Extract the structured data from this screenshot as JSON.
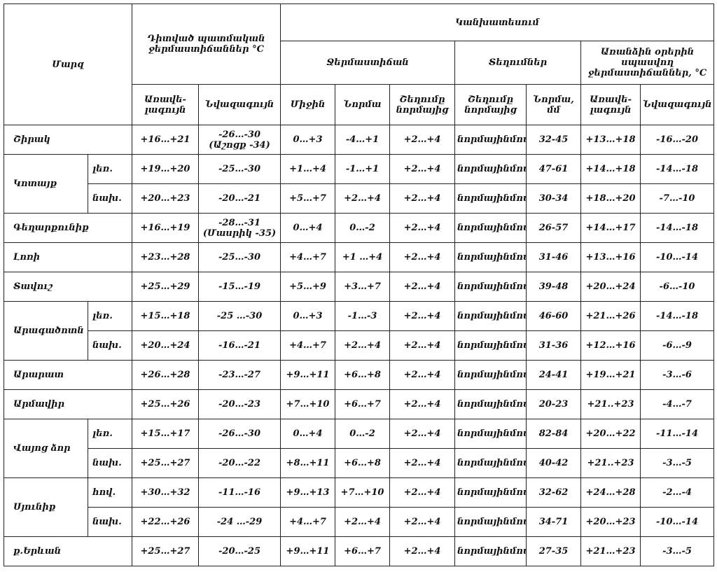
{
  "header": {
    "region": "Մարզ",
    "observed_title": "Դիտված պատմական ջերմաստիճաններ °C",
    "observed_max": "Առավե-լագույն",
    "observed_min": "Նվազագույն",
    "forecast_title": "Կանխատեսում",
    "temperature_title": "Ջերմաստիճան",
    "temp_mean": "Միջին",
    "temp_norm": "Նորմա",
    "temp_deviation": "Շեղումը նորմայից",
    "precip_title": "Տեղումներ",
    "precip_deviation": "Շեղումը նորմայից",
    "precip_norm": "Նորմա, մմ",
    "special_title": "Առանձին օրերին սպասվող ջերմաստիճաններ, °C",
    "special_max": "Առավե-լագույն",
    "special_min": "Նվազագույն"
  },
  "rows": [
    {
      "region": "Շիրակ",
      "sub": "",
      "obs_max": "+16…+21",
      "obs_min": "-26…-30 (Աշոցք -34)",
      "mean": "0…+3",
      "norm": "-4…+1",
      "dev": "+2…+4",
      "precip_dev": "նորմայինմոտ",
      "precip_norm": "32-45",
      "spec_max": "+13…+18",
      "spec_min": "-16…-20"
    },
    {
      "region": "Կոտայք",
      "sub": "լեռ.",
      "obs_max": "+19…+20",
      "obs_min": "-25…-30",
      "mean": "+1…+4",
      "norm": "-1…+1",
      "dev": "+2…+4",
      "precip_dev": "նորմայինմոտ",
      "precip_norm": "47-61",
      "spec_max": "+14…+18",
      "spec_min": "-14…-18"
    },
    {
      "region": "",
      "sub": "նախ.",
      "obs_max": "+20…+23",
      "obs_min": "-20…-21",
      "mean": "+5…+7",
      "norm": "+2…+4",
      "dev": "+2…+4",
      "precip_dev": "նորմայինմոտ",
      "precip_norm": "30-34",
      "spec_max": "+18…+20",
      "spec_min": "-7…-10"
    },
    {
      "region": "Գեղարքունիք",
      "sub": "",
      "obs_max": "+16…+19",
      "obs_min": "-28…-31 (Մասրիկ -35)",
      "mean": "0…+4",
      "norm": "0…-2",
      "dev": "+2…+4",
      "precip_dev": "նորմայինմոտ",
      "precip_norm": "26-57",
      "spec_max": "+14…+17",
      "spec_min": "-14…-18"
    },
    {
      "region": "Լոռի",
      "sub": "",
      "obs_max": "+23…+28",
      "obs_min": "-25…-30",
      "mean": "+4…+7",
      "norm": "+1 …+4",
      "dev": "+2…+4",
      "precip_dev": "նորմայինմոտ",
      "precip_norm": "31-46",
      "spec_max": "+13…+16",
      "spec_min": "-10…-14"
    },
    {
      "region": "Տավուշ",
      "sub": "",
      "obs_max": "+25…+29",
      "obs_min": "-15…-19",
      "mean": "+5…+9",
      "norm": "+3…+7",
      "dev": "+2…+4",
      "precip_dev": "նորմայինմոտ",
      "precip_norm": "39-48",
      "spec_max": "+20…+24",
      "spec_min": "-6…-10"
    },
    {
      "region": "Արագածոտն",
      "sub": "լեռ.",
      "obs_max": "+15…+18",
      "obs_min": "-25 …-30",
      "mean": "0…+3",
      "norm": "-1…-3",
      "dev": "+2…+4",
      "precip_dev": "նորմայինմոտ",
      "precip_norm": "46-60",
      "spec_max": "+21…+26",
      "spec_min": "-14…-18"
    },
    {
      "region": "",
      "sub": "նախ.",
      "obs_max": "+20…+24",
      "obs_min": "-16…-21",
      "mean": "+4…+7",
      "norm": "+2…+4",
      "dev": "+2…+4",
      "precip_dev": "նորմայինմոտ",
      "precip_norm": "31-36",
      "spec_max": "+12…+16",
      "spec_min": "-6…-9"
    },
    {
      "region": "Արարատ",
      "sub": "",
      "obs_max": "+26…+28",
      "obs_min": "-23…-27",
      "mean": "+9…+11",
      "norm": "+6…+8",
      "dev": "+2…+4",
      "precip_dev": "նորմայինմոտ",
      "precip_norm": "24-41",
      "spec_max": "+19…+21",
      "spec_min": "-3…-6"
    },
    {
      "region": "Արմավիր",
      "sub": "",
      "obs_max": "+25…+26",
      "obs_min": "-20…-23",
      "mean": "+7…+10",
      "norm": "+6…+7",
      "dev": "+2…+4",
      "precip_dev": "նորմայինմոտ",
      "precip_norm": "20-23",
      "spec_max": "+21..+23",
      "spec_min": "-4…-7"
    },
    {
      "region": "Վայոց ձոր",
      "sub": "լեռ.",
      "obs_max": "+15…+17",
      "obs_min": "-26…-30",
      "mean": "0…+4",
      "norm": "0…-2",
      "dev": "+2…+4",
      "precip_dev": "նորմայինմոտ",
      "precip_norm": "82-84",
      "spec_max": "+20…+22",
      "spec_min": "-11…-14"
    },
    {
      "region": "",
      "sub": "նախ.",
      "obs_max": "+25…+27",
      "obs_min": "-20…-22",
      "mean": "+8…+11",
      "norm": "+6…+8",
      "dev": "+2…+4",
      "precip_dev": "նորմայինմոտ",
      "precip_norm": "40-42",
      "spec_max": "+21..+23",
      "spec_min": "-3…-5"
    },
    {
      "region": "Սյունիք",
      "sub": "հով.",
      "obs_max": "+30…+32",
      "obs_min": "-11…-16",
      "mean": "+9…+13",
      "norm": "+7…+10",
      "dev": "+2…+4",
      "precip_dev": "նորմայինմոտ",
      "precip_norm": "32-62",
      "spec_max": "+24…+28",
      "spec_min": "-2…-4"
    },
    {
      "region": "",
      "sub": "նախ.",
      "obs_max": "+22…+26",
      "obs_min": "-24 …-29",
      "mean": "+4…+7",
      "norm": "+2…+4",
      "dev": "+2…+4",
      "precip_dev": "նորմայինմոտ",
      "precip_norm": "34-71",
      "spec_max": "+20…+23",
      "spec_min": "-10…-14"
    },
    {
      "region": "ք.Երևան",
      "sub": "",
      "obs_max": "+25…+27",
      "obs_min": "-20…-25",
      "mean": "+9…+11",
      "norm": "+6…+7",
      "dev": "+2…+4",
      "precip_dev": "նորմայինմոտ",
      "precip_norm": "27-35",
      "spec_max": "+21…+23",
      "spec_min": "-3…-5"
    }
  ]
}
